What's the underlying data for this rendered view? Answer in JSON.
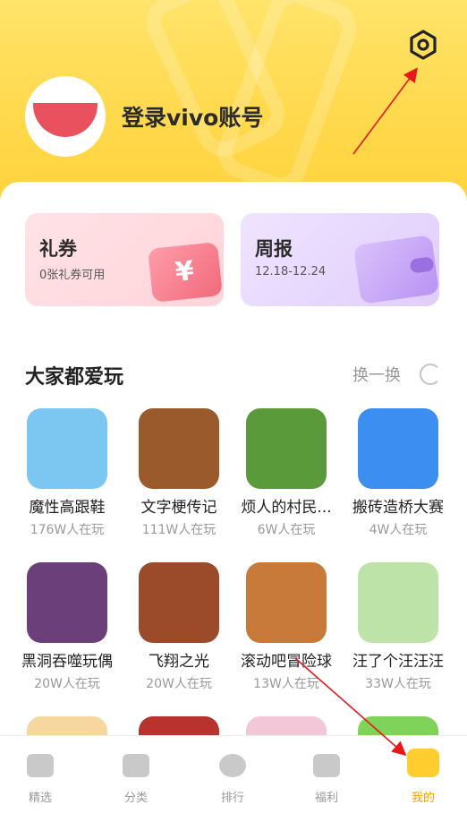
{
  "header": {
    "login_text": "登录vivo账号",
    "settings_icon": "settings-icon"
  },
  "cards": {
    "coupon": {
      "title": "礼券",
      "subtitle": "0张礼券可用",
      "icon_glyph": "¥"
    },
    "weekly": {
      "title": "周报",
      "subtitle": "12.18-12.24"
    }
  },
  "section": {
    "title": "大家都爱玩",
    "refresh_label": "换一换"
  },
  "games": [
    {
      "name": "魔性高跟鞋",
      "players": "176W人在玩",
      "color": "#7cc7f2"
    },
    {
      "name": "文字梗传记",
      "players": "111W人在玩",
      "color": "#9b5a2c"
    },
    {
      "name": "烦人的村民...",
      "players": "6W人在玩",
      "color": "#5a9a3a"
    },
    {
      "name": "搬砖造桥大赛",
      "players": "4W人在玩",
      "color": "#3c8ff0"
    },
    {
      "name": "黑洞吞噬玩偶",
      "players": "20W人在玩",
      "color": "#6a3f7a"
    },
    {
      "name": "飞翔之光",
      "players": "20W人在玩",
      "color": "#9b4a2a"
    },
    {
      "name": "滚动吧冒险球",
      "players": "13W人在玩",
      "color": "#c77a3a"
    },
    {
      "name": "汪了个汪汪汪",
      "players": "33W人在玩",
      "color": "#bde3a8"
    }
  ],
  "tabs": [
    {
      "label": "精选",
      "icon": "gamepad-icon"
    },
    {
      "label": "分类",
      "icon": "folder-icon"
    },
    {
      "label": "排行",
      "icon": "medal-icon"
    },
    {
      "label": "福利",
      "icon": "gift-icon"
    },
    {
      "label": "我的",
      "icon": "profile-cat-icon"
    }
  ],
  "colors": {
    "header_yellow": "#ffd84a",
    "active_tab": "#ff9d00",
    "annotation_arrow": "#e8171a"
  }
}
